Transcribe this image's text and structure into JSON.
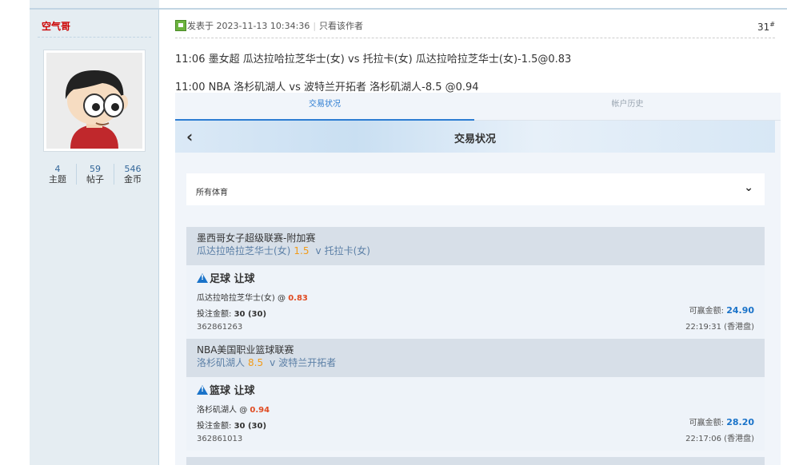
{
  "sidebar": {
    "author": "空气哥",
    "stats": [
      {
        "value": "4",
        "label": "主题"
      },
      {
        "value": "59",
        "label": "帖子"
      },
      {
        "value": "546",
        "label": "金币"
      }
    ]
  },
  "post": {
    "posted_at": "发表于 2023-11-13 10:34:36",
    "author_only": "只看该作者",
    "floor": "31",
    "floor_mark": "#",
    "line1": "11:06 墨女超 瓜达拉哈拉芝华士(女) vs 托拉卡(女)  瓜达拉哈拉芝华士(女)-1.5@0.83",
    "line2": "11:00  NBA  洛杉矶湖人  vs 波特兰开拓者  洛杉矶湖人-8.5 @0.94"
  },
  "app": {
    "tabs": [
      "交易状况",
      "帐户历史"
    ],
    "title": "交易状况",
    "filter": "所有体育",
    "bets": [
      {
        "league": "墨西哥女子超级联赛-附加赛",
        "home": "瓜达拉哈拉芝华士(女)",
        "handicap": "1.5",
        "vs": "v",
        "away": "托拉卡(女)",
        "bet_type": "足球 让球",
        "selection": "瓜达拉哈拉芝华士(女)",
        "at": "@",
        "odds": "0.83",
        "stake_label": "投注金额:",
        "stake": "30 (30)",
        "ref": "362861263",
        "win_label": "可赢金额:",
        "win": "24.90",
        "time": "22:19:31 (香港盘)"
      },
      {
        "league": "NBA美国职业篮球联赛",
        "home": "洛杉矶湖人",
        "handicap": "8.5",
        "vs": "v",
        "away": "波特兰开拓者",
        "bet_type": "篮球 让球",
        "selection": "洛杉矶湖人",
        "at": "@",
        "odds": "0.94",
        "stake_label": "投注金额:",
        "stake": "30 (30)",
        "ref": "362861013",
        "win_label": "可赢金额:",
        "win": "28.20",
        "time": "22:17:06 (香港盘)"
      }
    ]
  },
  "colors": {
    "sidebar_bg": "#e5edf2",
    "author": "#cc0000",
    "accent_blue": "#1a73c9",
    "handicap_orange": "#f29b18",
    "odds_red": "#e04b22"
  }
}
